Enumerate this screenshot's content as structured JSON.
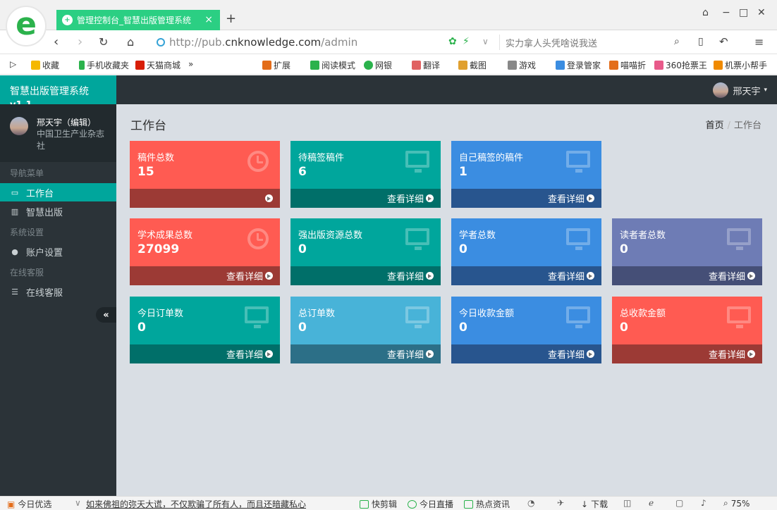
{
  "browser": {
    "tab_title": "管理控制台_智慧出版管理系统",
    "url_prefix": "http://pub.",
    "url_host": "cnknowledge.com",
    "url_path": "/admin",
    "search_placeholder": "实力拿人头凭啥说我送",
    "bookmarks": [
      "收藏",
      "手机收藏夹",
      "天猫商城",
      "»",
      "扩展",
      "阅读模式",
      "网银",
      "翻译",
      "截图",
      "游戏",
      "登录管家",
      "喵喵折",
      "360抢票王",
      "机票小帮手"
    ]
  },
  "app": {
    "brand": "智慧出版管理系统",
    "version": "v1.1",
    "user_name": "邢天宇（编辑）",
    "user_org": "中国卫生产业杂志社",
    "top_user": "邢天宇",
    "nav": {
      "section_main": "导航菜单",
      "item_workbench": "工作台",
      "item_publish": "智慧出版",
      "section_settings": "系统设置",
      "item_account": "账户设置",
      "section_service": "在线客服",
      "item_service": "在线客服",
      "collapse": "«"
    },
    "page_title": "工作台",
    "breadcrumb": {
      "home": "首页",
      "sep": "/",
      "current": "工作台"
    }
  },
  "cards": [
    {
      "label": "稿件总数",
      "value": "15",
      "more": "",
      "color": "#ff5b52",
      "bottom": "#9c3a35",
      "icon": "clock-icon"
    },
    {
      "label": "待稿签稿件",
      "value": "6",
      "more": "查看详细",
      "color": "#00a69c",
      "bottom": "#006f69",
      "icon": "monitor-icon"
    },
    {
      "label": "自己稿签的稿件",
      "value": "1",
      "more": "查看详细",
      "color": "#3b8de1",
      "bottom": "#28558e",
      "icon": "monitor-icon"
    },
    {
      "label": "学术成果总数",
      "value": "27099",
      "more": "查看详细",
      "color": "#ff5b52",
      "bottom": "#9c3a35",
      "icon": "clock-icon"
    },
    {
      "label": "强出版资源总数",
      "value": "0",
      "more": "查看详细",
      "color": "#00a69c",
      "bottom": "#006f69",
      "icon": "monitor-icon"
    },
    {
      "label": "学者总数",
      "value": "0",
      "more": "查看详细",
      "color": "#3b8de1",
      "bottom": "#28558e",
      "icon": "monitor-icon"
    },
    {
      "label": "读者者总数",
      "value": "0",
      "more": "查看详细",
      "color": "#6e7cb5",
      "bottom": "#454f77",
      "icon": "monitor-icon"
    },
    {
      "label": "今日订单数",
      "value": "0",
      "more": "查看详细",
      "color": "#00a69c",
      "bottom": "#006f69",
      "icon": "monitor-icon"
    },
    {
      "label": "总订单数",
      "value": "0",
      "more": "查看详细",
      "color": "#48b3d8",
      "bottom": "#2c6f87",
      "icon": "monitor-icon"
    },
    {
      "label": "今日收款金额",
      "value": "0",
      "more": "查看详细",
      "color": "#3b8de1",
      "bottom": "#28558e",
      "icon": "monitor-icon"
    },
    {
      "label": "总收款金额",
      "value": "0",
      "more": "查看详细",
      "color": "#ff5b52",
      "bottom": "#9c3a35",
      "icon": "monitor-icon"
    }
  ],
  "status": {
    "today_pick": "今日优选",
    "headline": "如来佛祖的弥天大谎，不仅欺骗了所有人，而且还暗藏私心",
    "quick_clip": "快剪辑",
    "live": "今日直播",
    "hot_news": "热点资讯",
    "download": "下载",
    "zoom": "75%"
  }
}
